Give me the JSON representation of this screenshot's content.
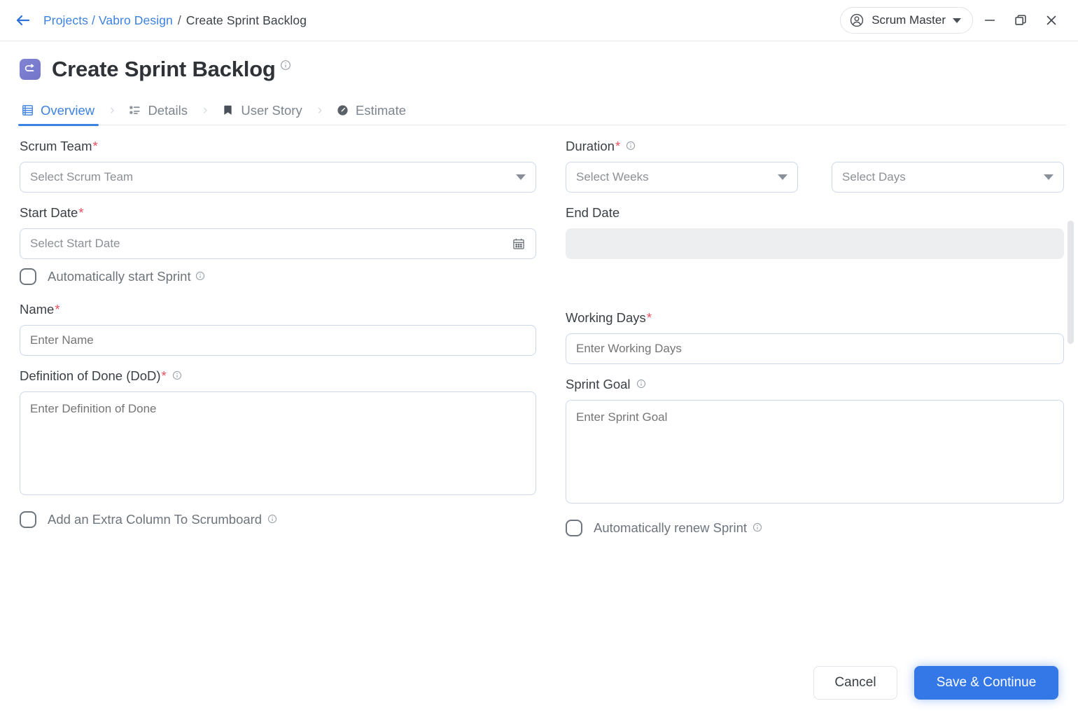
{
  "titlebar": {
    "back_icon": "arrow-left-icon",
    "breadcrumb": {
      "projects": "Projects",
      "sep1": "/",
      "project": "Vabro Design",
      "sep2": "/",
      "current": "Create Sprint Backlog"
    },
    "user": {
      "name": "Scrum Master",
      "avatar_icon": "user-circle-icon",
      "caret_icon": "chevron-down-icon"
    },
    "window": {
      "minimize": "minimize-icon",
      "restore": "restore-icon",
      "close": "close-icon"
    }
  },
  "header": {
    "title": "Create Sprint Backlog",
    "icon": "sprint-backlog-icon",
    "info_icon": "info-icon"
  },
  "tabs": [
    {
      "label": "Overview",
      "icon": "list-view-icon",
      "active": true
    },
    {
      "label": "Details",
      "icon": "details-list-icon",
      "active": false
    },
    {
      "label": "User Story",
      "icon": "bookmark-icon",
      "active": false
    },
    {
      "label": "Estimate",
      "icon": "clock-icon",
      "active": false
    }
  ],
  "tab_separator": "›",
  "form": {
    "scrum_team": {
      "label": "Scrum Team",
      "required": "*",
      "placeholder": "Select Scrum Team",
      "value": ""
    },
    "duration": {
      "label": "Duration",
      "required": "*",
      "weeks_placeholder": "Select Weeks",
      "weeks_value": "",
      "days_placeholder": "Select Days",
      "days_value": ""
    },
    "start_date": {
      "label": "Start Date",
      "required": "*",
      "placeholder": "Select Start Date",
      "value": "",
      "icon": "calendar-icon"
    },
    "end_date": {
      "label": "End Date",
      "value": "",
      "disabled": true
    },
    "auto_start": {
      "label": "Automatically start Sprint",
      "checked": false
    },
    "name": {
      "label": "Name",
      "required": "*",
      "placeholder": "Enter Name",
      "value": ""
    },
    "working_days": {
      "label": "Working Days",
      "required": "*",
      "placeholder": "Enter Working Days",
      "value": ""
    },
    "dod": {
      "label": "Definition of Done (DoD)",
      "required": "*",
      "placeholder": "Enter Definition of Done",
      "value": ""
    },
    "sprint_goal": {
      "label": "Sprint Goal",
      "placeholder": "Enter Sprint Goal",
      "value": ""
    },
    "extra_column": {
      "label": "Add an Extra Column To Scrumboard",
      "checked": false
    },
    "auto_renew": {
      "label": "Automatically renew Sprint",
      "checked": false
    }
  },
  "footer": {
    "cancel_label": "Cancel",
    "save_label": "Save & Continue"
  },
  "colors": {
    "accent": "#3c82e0",
    "primary_button": "#3478e8",
    "required": "#e8505f",
    "title_icon": "#7b7bc8",
    "border": "#ccd8ea"
  }
}
